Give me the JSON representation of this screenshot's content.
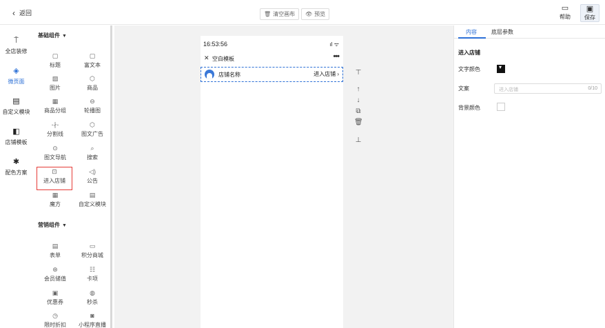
{
  "topbar": {
    "back_label": "返回",
    "clear_label": "清空画布",
    "preview_label": "预览",
    "help_label": "帮助",
    "save_label": "保存"
  },
  "leftnav": [
    {
      "label": "全店装修",
      "icon": "paint-roller-icon"
    },
    {
      "label": "微页面",
      "icon": "layers-icon",
      "active": true
    },
    {
      "label": "自定义模块",
      "icon": "custom-module-icon"
    },
    {
      "label": "店铺模板",
      "icon": "template-icon"
    },
    {
      "label": "配色方案",
      "icon": "palette-icon"
    }
  ],
  "components": {
    "basic_title": "基础组件",
    "basic": [
      {
        "label": "标题",
        "icon": "title-icon"
      },
      {
        "label": "富文本",
        "icon": "richtext-icon"
      },
      {
        "label": "图片",
        "icon": "image-icon"
      },
      {
        "label": "商品",
        "icon": "product-icon"
      },
      {
        "label": "商品分组",
        "icon": "product-group-icon"
      },
      {
        "label": "轮播图",
        "icon": "carousel-icon"
      },
      {
        "label": "分割线",
        "icon": "divider-icon"
      },
      {
        "label": "图文广告",
        "icon": "ad-icon"
      },
      {
        "label": "图文导航",
        "icon": "nav-icon"
      },
      {
        "label": "搜索",
        "icon": "search-icon"
      },
      {
        "label": "进入店铺",
        "icon": "enter-shop-icon"
      },
      {
        "label": "公告",
        "icon": "notice-icon"
      },
      {
        "label": "魔方",
        "icon": "grid-icon"
      },
      {
        "label": "自定义模块",
        "icon": "custom-module-icon"
      }
    ],
    "marketing_title": "营销组件",
    "marketing": [
      {
        "label": "表单",
        "icon": "form-icon"
      },
      {
        "label": "积分商城",
        "icon": "points-mall-icon"
      },
      {
        "label": "会员储值",
        "icon": "member-icon"
      },
      {
        "label": "卡项",
        "icon": "card-icon"
      },
      {
        "label": "优惠券",
        "icon": "coupon-icon"
      },
      {
        "label": "秒杀",
        "icon": "flash-sale-icon"
      },
      {
        "label": "限时折扣",
        "icon": "discount-icon"
      },
      {
        "label": "小程序直播",
        "icon": "live-icon"
      }
    ]
  },
  "phone": {
    "time": "16:53:56",
    "signal": "ıl ᯤ",
    "page_title": "空白模板",
    "shop_name": "店铺名称",
    "enter_label": "进入店铺"
  },
  "right": {
    "tab_content": "内容",
    "tab_layer": "底层参数",
    "section_title": "进入店铺",
    "text_color_label": "文字颜色",
    "text_color": "#111111",
    "copy_label": "文案",
    "copy_placeholder": "进入店铺",
    "copy_count": "0/10",
    "bg_color_label": "背景颜色"
  }
}
